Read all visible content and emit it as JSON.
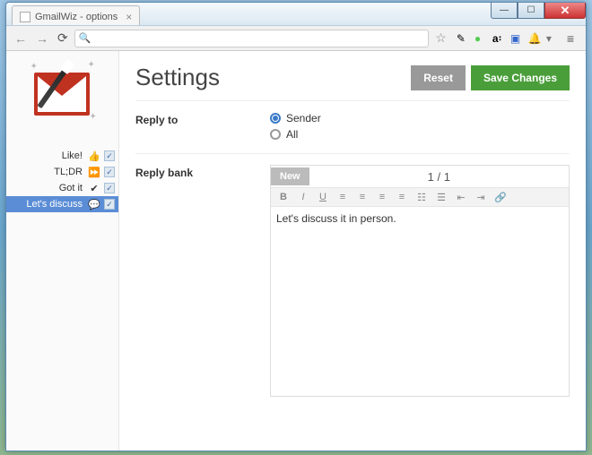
{
  "window": {
    "tab_title": "GmailWiz - options"
  },
  "header": {
    "title": "Settings",
    "reset_label": "Reset",
    "save_label": "Save Changes"
  },
  "sections": {
    "reply_to_label": "Reply to",
    "reply_bank_label": "Reply bank"
  },
  "reply_to": {
    "options": [
      {
        "label": "Sender",
        "checked": true
      },
      {
        "label": "All",
        "checked": false
      }
    ]
  },
  "sidebar_items": [
    {
      "label": "Like!",
      "icon": "thumb-up",
      "checked": true,
      "selected": false
    },
    {
      "label": "TL;DR",
      "icon": "fast-forward",
      "checked": true,
      "selected": false
    },
    {
      "label": "Got it",
      "icon": "check",
      "checked": true,
      "selected": false
    },
    {
      "label": "Let's discuss",
      "icon": "speech",
      "checked": true,
      "selected": true
    }
  ],
  "editor": {
    "new_label": "New",
    "pager": "1 / 1",
    "content": "Let's discuss it in person."
  }
}
